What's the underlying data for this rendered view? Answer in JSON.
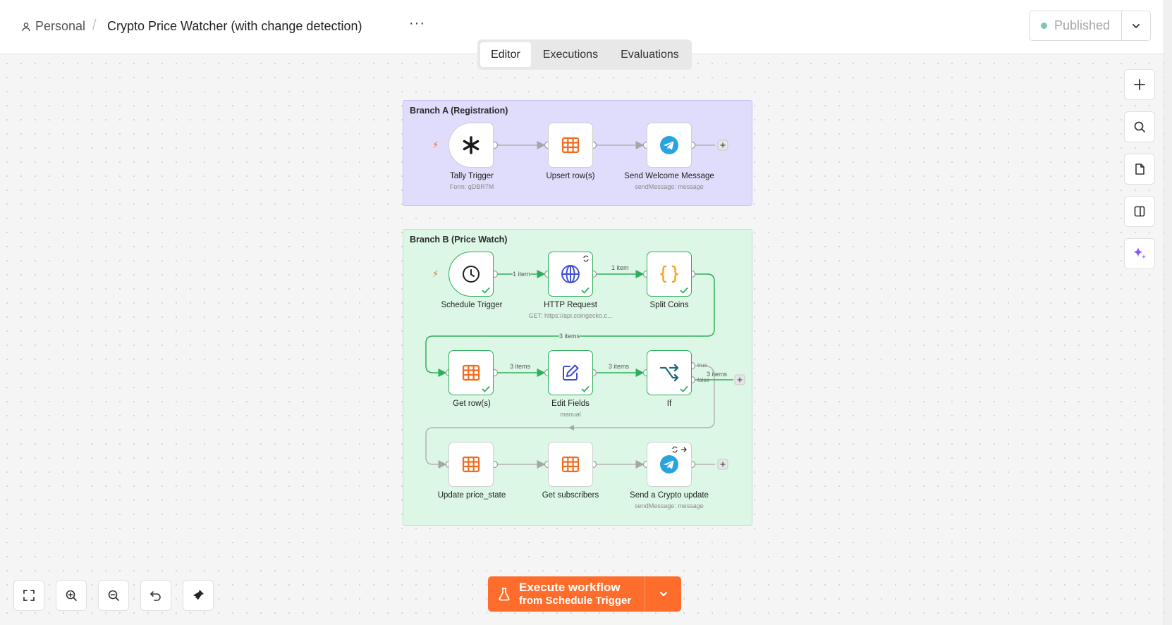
{
  "header": {
    "breadcrumb_personal": "Personal",
    "breadcrumb_separator": "/",
    "workflow_title": "Crypto Price Watcher (with change detection)",
    "more_label": "···",
    "status_label": "Published",
    "status_color": "#7cc6b8"
  },
  "tabs": [
    {
      "label": "Editor",
      "active": true
    },
    {
      "label": "Executions",
      "active": false
    },
    {
      "label": "Evaluations",
      "active": false
    }
  ],
  "right_toolbar": [
    "plus-icon",
    "search-icon",
    "sticky-note-icon",
    "panel-icon",
    "ai-sparkle-icon"
  ],
  "canvas": {
    "branch_a": {
      "title": "Branch A (Registration)",
      "color": "#e0dcfc",
      "nodes": [
        {
          "label": "Tally Trigger",
          "subtitle": "Form: gDBR7M",
          "icon": "tally-asterisk-icon"
        },
        {
          "label": "Upsert row(s)",
          "subtitle": "",
          "icon": "table-icon"
        },
        {
          "label": "Send Welcome Message",
          "subtitle": "sendMessage: message",
          "icon": "telegram-icon"
        }
      ]
    },
    "branch_b": {
      "title": "Branch B (Price Watch)",
      "color": "#dcf7e6",
      "nodes": [
        {
          "label": "Schedule Trigger",
          "subtitle": "",
          "icon": "clock-icon"
        },
        {
          "label": "HTTP Request",
          "subtitle": "GET: https://api.coingecko.c...",
          "icon": "globe-icon"
        },
        {
          "label": "Split Coins",
          "subtitle": "",
          "icon": "braces-icon"
        },
        {
          "label": "Get row(s)",
          "subtitle": "",
          "icon": "table-icon"
        },
        {
          "label": "Edit Fields",
          "subtitle": "manual",
          "icon": "pencil-icon"
        },
        {
          "label": "If",
          "subtitle": "",
          "icon": "branch-icon"
        },
        {
          "label": "Update price_state",
          "subtitle": "",
          "icon": "table-icon"
        },
        {
          "label": "Get subscribers",
          "subtitle": "",
          "icon": "table-icon"
        },
        {
          "label": "Send a Crypto update",
          "subtitle": "sendMessage: message",
          "icon": "telegram-icon"
        }
      ],
      "edge_labels": {
        "schedule_http": "1 item",
        "http_split": "1 item",
        "split_getrows": "3 items",
        "getrows_edit": "3 items",
        "edit_if": "3 items",
        "if_false": "3 items",
        "if_true_port": "true",
        "if_false_port": "false"
      }
    }
  },
  "execute_button": {
    "title": "Execute workflow",
    "subtitle": "from Schedule Trigger",
    "color": "#ff6d2d"
  },
  "bottom_controls": [
    "fit-view-icon",
    "zoom-in-icon",
    "zoom-out-icon",
    "undo-icon",
    "tidy-up-icon"
  ]
}
